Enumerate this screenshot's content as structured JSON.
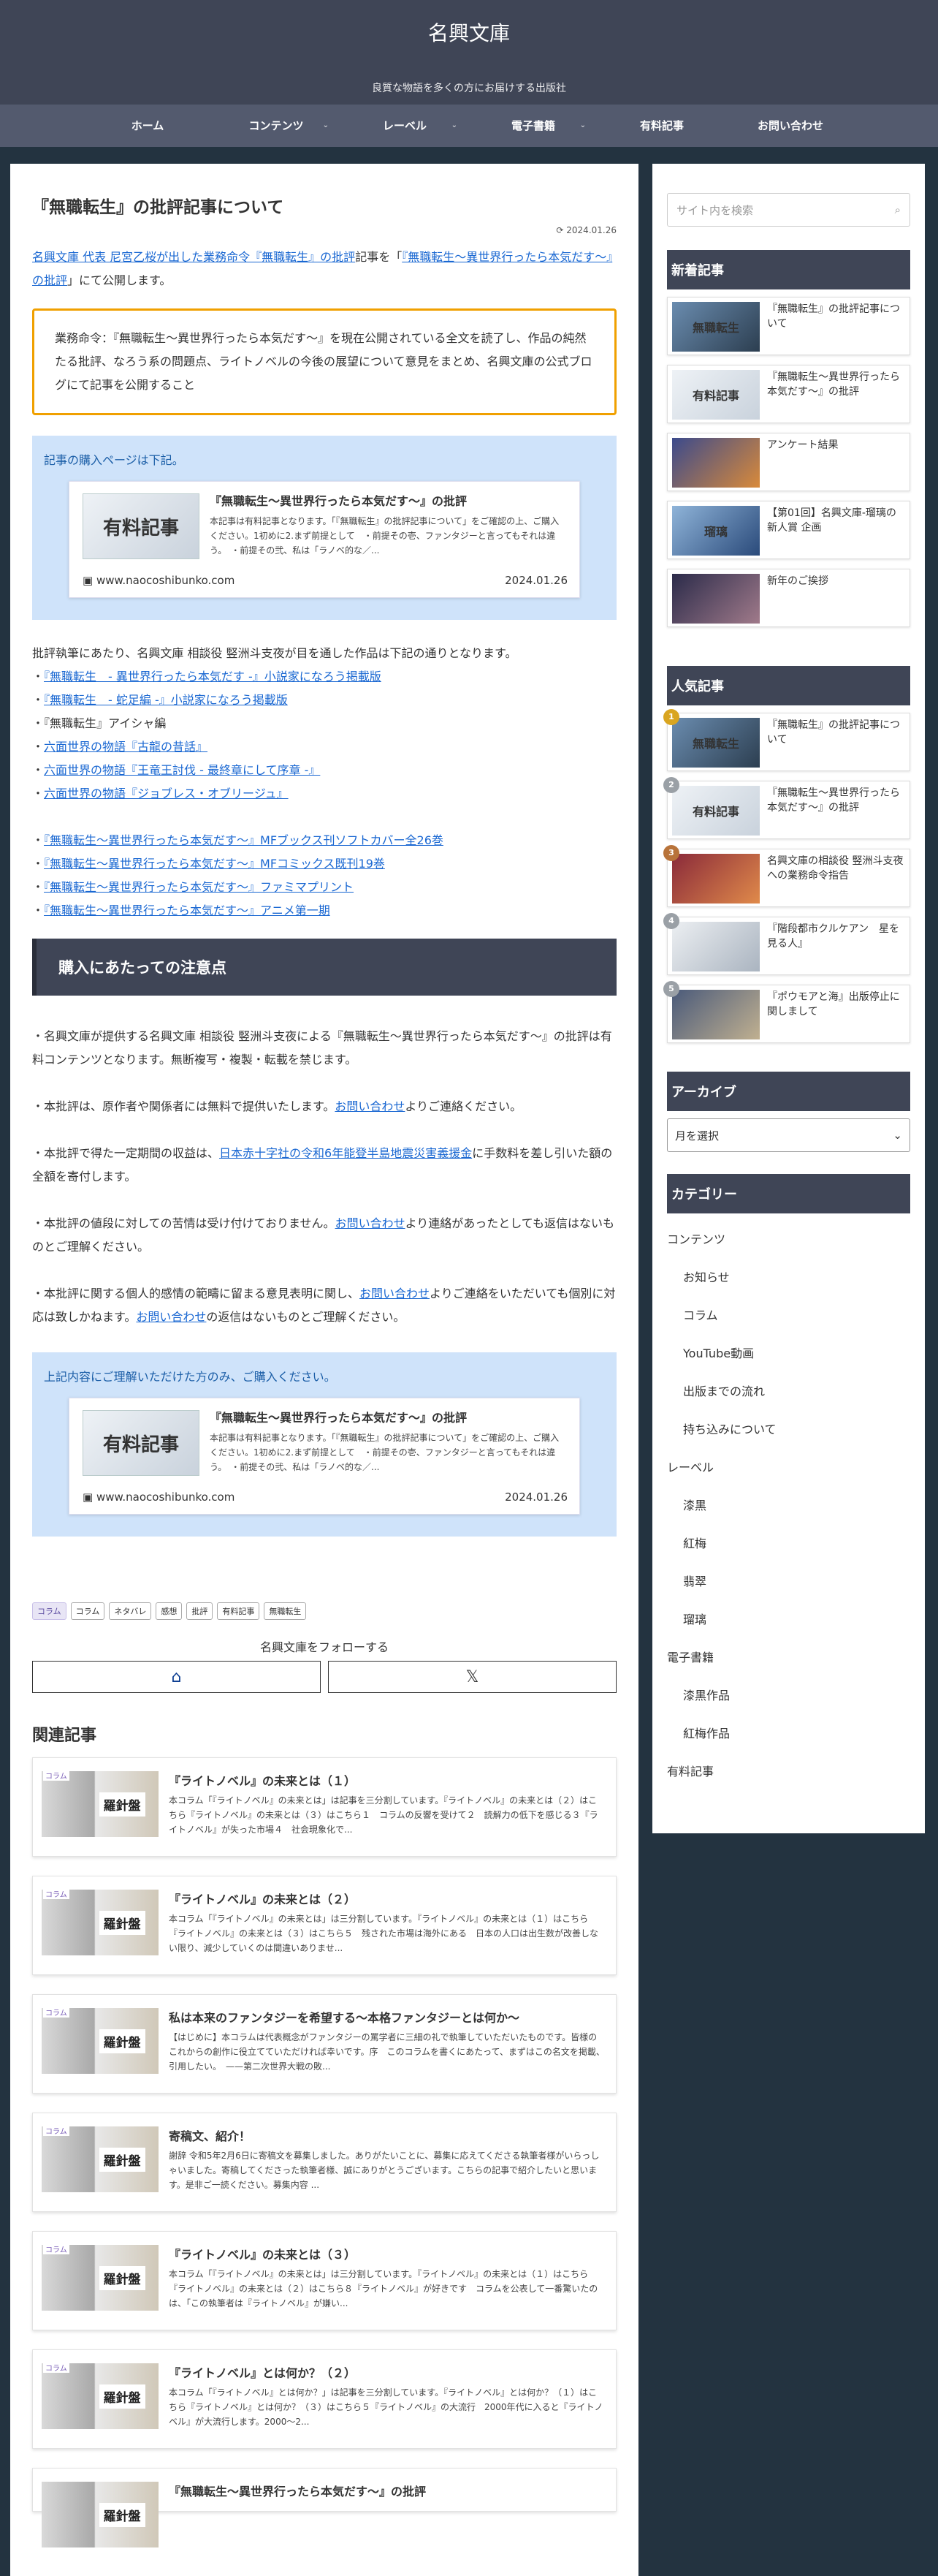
{
  "site": {
    "title": "名興文庫",
    "tagline": "良質な物語を多くの方にお届けする出版社"
  },
  "nav": [
    {
      "label": "ホーム",
      "chev": ""
    },
    {
      "label": "コンテンツ",
      "chev": "⌄"
    },
    {
      "label": "レーベル",
      "chev": "⌄"
    },
    {
      "label": "電子書籍",
      "chev": "⌄"
    },
    {
      "label": "有料記事",
      "chev": ""
    },
    {
      "label": "お問い合わせ",
      "chev": ""
    }
  ],
  "post": {
    "title": "『無職転生』の批評記事について",
    "date": "2024.01.26",
    "lead_prefix": "名興文庫 代表 尼宮乙桜が出した業務命令『無職転生』の批評",
    "lead_mid": "記事を「",
    "lead_link": "『無職転生〜異世界行ったら本気だす〜』の批評",
    "lead_suffix": "」にて公開します。",
    "quote": "業務命令：『無職転生〜異世界行ったら本気だす〜』を現在公開されている全文を読了し、作品の純然たる批評、なろう系の問題点、ライトノベルの今後の展望について意見をまとめ、名興文庫の公式ブログにて記事を公開すること",
    "purchase_note": "記事の購入ページは下記。",
    "card": {
      "thumb": "有料記事",
      "title": "『無職転生〜異世界行ったら本気だす〜』の批評",
      "desc": "本記事は有料記事となります。「『無職転生』の批評記事について」をご確認の上、ご購入ください。1初めに2.まず前提として　・前提その壱、ファンタジーと言ってもそれは違う。　・前提その弐、私は「ラノベ的な／...",
      "site": "www.naocoshibunko.com",
      "date": "2024.01.26"
    },
    "works_intro": "批評執筆にあたり、名興文庫 相談役 竪洲斗支夜が目を通した作品は下記の通りとなります。",
    "works": [
      {
        "text": "『無職転生　- 異世界行ったら本気だす -』小説家になろう掲載版",
        "link": true
      },
      {
        "text": "『無職転生　- 蛇足編 -』小説家になろう掲載版",
        "link": true
      },
      {
        "text": "『無職転生』アイシャ編",
        "link": false
      },
      {
        "text": "六面世界の物語『古龍の昔話』",
        "link": true
      },
      {
        "text": "六面世界の物語『王竜王討伐 - 最終章にして序章 -』",
        "link": true
      },
      {
        "text": "六面世界の物語『ジョブレス・オブリージュ』",
        "link": true
      }
    ],
    "works2": [
      {
        "text": "『無職転生〜異世界行ったら本気だす〜』MFブックス刊ソフトカバー全26巻",
        "link": true
      },
      {
        "text": "『無職転生〜異世界行ったら本気だす〜』MFコミックス既刊19巻",
        "link": true
      },
      {
        "text": "『無職転生〜異世界行ったら本気だす〜』ファミマプリント",
        "link": true
      },
      {
        "text": "『無職転生〜異世界行ったら本気だす〜』アニメ第一期",
        "link": true
      }
    ],
    "h2": "購入にあたっての注意点",
    "p1": "・名興文庫が提供する名興文庫 相談役 竪洲斗支夜による『無職転生〜異世界行ったら本気だす〜』の批評は有料コンテンツとなります。無断複写・複製・転載を禁じます。",
    "p2a": "・本批評は、原作者や関係者には無料で提供いたします。",
    "p2link": "お問い合わせ",
    "p2b": "よりご連絡ください。",
    "p3a": "・本批評で得た一定期間の収益は、",
    "p3link": "日本赤十字社の令和6年能登半島地震災害義援金",
    "p3b": "に手数料を差し引いた額の全額を寄付します。",
    "p4a": "・本批評の値段に対しての苦情は受け付けておりません。",
    "p4link": "お問い合わせ",
    "p4b": "より連絡があったとしても返信はないものとご理解ください。",
    "p5a": "・本批評に関する個人的感情の範疇に留まる意見表明に関し、",
    "p5link": "お問い合わせ",
    "p5b": "よりご連絡をいただいても個別に対応は致しかねます。",
    "p5link2": "お問い合わせ",
    "p5c": "の返信はないものとご理解ください。",
    "agree_note": "上記内容にご理解いただけた方のみ、ご購入ください。",
    "tags": [
      "コラム",
      "コラム",
      "ネタバレ",
      "感想",
      "批評",
      "有料記事",
      "無職転生"
    ],
    "follow": "名興文庫をフォローする",
    "follow_icons": [
      "home-icon",
      "x-icon"
    ]
  },
  "related": {
    "heading": "関連記事",
    "items": [
      {
        "cat": "コラム",
        "title": "『ライトノベル』の未来とは（１）",
        "desc": "本コラム「『ライトノベル』の未来とは」は記事を三分割しています。『ライトノベル』の未来とは（２）はこちら『ライトノベル』の未来とは（３）はこちら１　コラムの反響を受けて２　読解力の低下を感じる３『ライトノベル』が失った市場４　社会現象化で..."
      },
      {
        "cat": "コラム",
        "title": "『ライトノベル』の未来とは（２）",
        "desc": "本コラム「『ライトノベル』の未来とは」は三分割しています。『ライトノベル』の未来とは（１）はこちら『ライトノベル』の未来とは（３）はこちら５　残された市場は海外にある　日本の人口は出生数が改善しない限り、減少していくのは間違いありませ..."
      },
      {
        "cat": "コラム",
        "title": "私は本来のファンタジーを希望する〜本格ファンタジーとは何か〜",
        "desc": "【はじめに】本コラムは代表概念がファンタジーの罵学者に三細の礼で執筆していただいたものです。皆様のこれからの創作に役立てていただければ幸いです。序　このコラムを書くにあたって、まずはこの名文を掲載、引用したい。　——第二次世界大戦の敗..."
      },
      {
        "cat": "コラム",
        "title": "寄稿文、紹介！",
        "desc": "謝辞 令和5年2月6日に寄稿文を募集しました。ありがたいことに、募集に応えてくださる執筆者様がいらっしゃいました。寄稿してくださった執筆者様、誠にありがとうございます。こちらの記事で紹介したいと思います。是非ご一読ください。募集内容 ..."
      },
      {
        "cat": "コラム",
        "title": "『ライトノベル』の未来とは（３）",
        "desc": "本コラム「『ライトノベル』の未来とは」は三分割しています。『ライトノベル』の未来とは（１）はこちら『ライトノベル』の未来とは（２）はこちら８『ライトノベル』が好きです　コラムを公表して一番驚いたのは、「この執筆者は『ライトノベル』が嫌い..."
      },
      {
        "cat": "コラム",
        "title": "『ライトノベル』とは何か？（２）",
        "desc": "本コラム「『ライトノベル』とは何か？」は記事を三分割しています。『ライトノベル』とは何か？（１）はこちら『ライトノベル』とは何か？（３）はこちら５『ライトノベル』の大流行　2000年代に入ると『ライトノベル』が大流行します。2000〜2..."
      },
      {
        "cat": "",
        "title": "『無職転生〜異世界行ったら本気だす〜』の批評",
        "desc": ""
      }
    ]
  },
  "sidebar": {
    "search_placeholder": "サイト内を検索",
    "new_heading": "新着記事",
    "new_posts": [
      {
        "title": "『無職転生』の批評記事について",
        "thumb": "無職転生"
      },
      {
        "title": "『無職転生〜異世界行ったら本気だす〜』の批評",
        "thumb": "有料記事"
      },
      {
        "title": "アンケート結果",
        "thumb": ""
      },
      {
        "title": "【第01回】名興文庫-瑠璃の新人賞 企画",
        "thumb": "瑠璃"
      },
      {
        "title": "新年のご挨拶",
        "thumb": ""
      }
    ],
    "popular_heading": "人気記事",
    "popular_posts": [
      {
        "rank": "1",
        "title": "『無職転生』の批評記事について",
        "thumb": "無職転生"
      },
      {
        "rank": "2",
        "title": "『無職転生〜異世界行ったら本気だす〜』の批評",
        "thumb": "有料記事"
      },
      {
        "rank": "3",
        "title": "名興文庫の相談役 竪洲斗支夜への業務命令指告",
        "thumb": ""
      },
      {
        "rank": "4",
        "title": "『階段都市クルケアン　星を見る人』",
        "thumb": ""
      },
      {
        "rank": "5",
        "title": "『ポウモアと海』出版停止に関しまして",
        "thumb": ""
      }
    ],
    "rank_colors": [
      "#d9a520",
      "#9aa0a6",
      "#b8733a",
      "#9aa0a6",
      "#9aa0a6"
    ],
    "archive_heading": "アーカイブ",
    "archive_select": "月を選択",
    "category_heading": "カテゴリー",
    "categories": [
      {
        "label": "コンテンツ",
        "sub": false
      },
      {
        "label": "お知らせ",
        "sub": true
      },
      {
        "label": "コラム",
        "sub": true
      },
      {
        "label": "YouTube動画",
        "sub": true
      },
      {
        "label": "出版までの流れ",
        "sub": true
      },
      {
        "label": "持ち込みについて",
        "sub": true
      },
      {
        "label": "レーベル",
        "sub": false
      },
      {
        "label": "漆黒",
        "sub": true
      },
      {
        "label": "紅梅",
        "sub": true
      },
      {
        "label": "翡翠",
        "sub": true
      },
      {
        "label": "瑠璃",
        "sub": true
      },
      {
        "label": "電子書籍",
        "sub": false
      },
      {
        "label": "漆黒作品",
        "sub": true
      },
      {
        "label": "紅梅作品",
        "sub": true
      },
      {
        "label": "有料記事",
        "sub": false
      }
    ]
  },
  "colors": {
    "header": "#3f4556",
    "nav": "#535a6e",
    "accent": "#f0a000",
    "blue_box": "#cfe3fa",
    "link": "#1967d2"
  }
}
